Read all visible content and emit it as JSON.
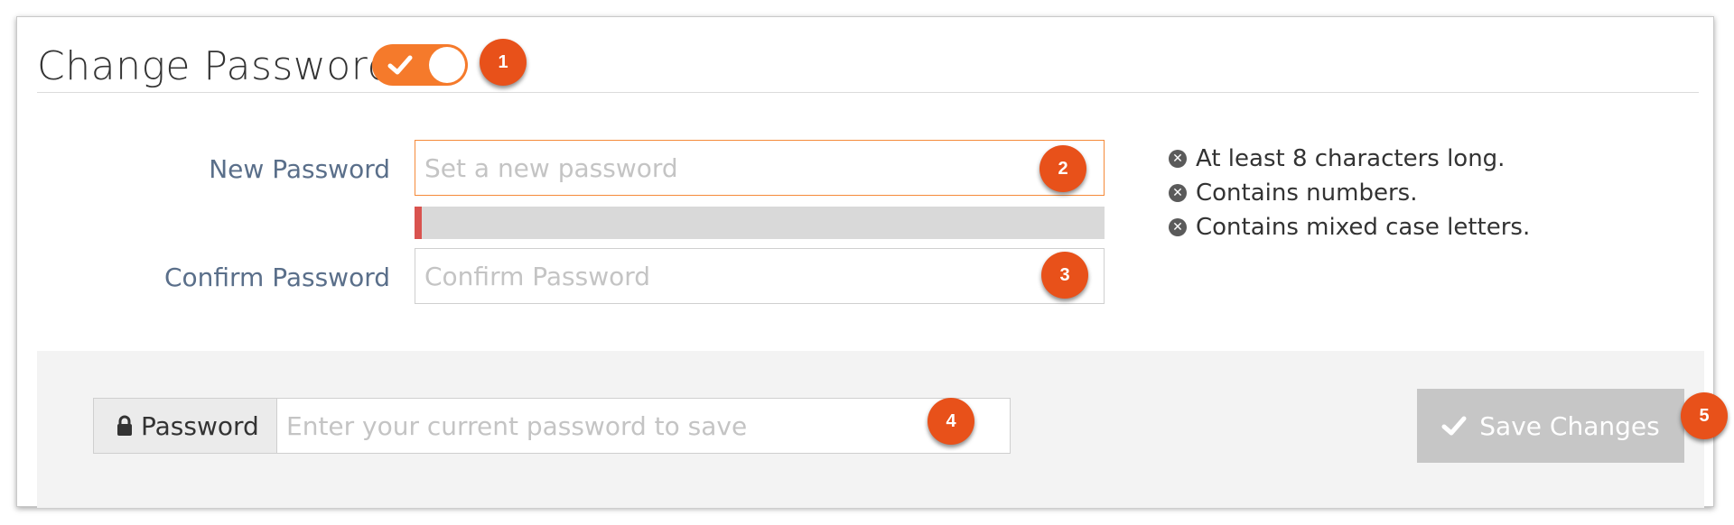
{
  "header": {
    "title": "Change Password?",
    "toggle_on": true
  },
  "form": {
    "new_password": {
      "label": "New Password",
      "placeholder": "Set a new password"
    },
    "strength": {
      "level": 0.01,
      "color": "#d9534f"
    },
    "confirm_password": {
      "label": "Confirm Password",
      "placeholder": "Confirm Password"
    },
    "rules": [
      {
        "text": "At least 8 characters long.",
        "icon": "x-circle-icon"
      },
      {
        "text": "Contains numbers.",
        "icon": "x-circle-icon"
      },
      {
        "text": "Contains mixed case letters.",
        "icon": "x-circle-icon"
      }
    ]
  },
  "footer": {
    "current_password_addon": "Password",
    "current_password_placeholder": "Enter your current password to save",
    "save_label": "Save Changes"
  },
  "annotations": [
    "1",
    "2",
    "3",
    "4",
    "5"
  ],
  "colors": {
    "accent": "#f57a2b",
    "badge": "#e8511a",
    "label": "#5a6f8a",
    "disabled_button": "#c6c6c6"
  }
}
